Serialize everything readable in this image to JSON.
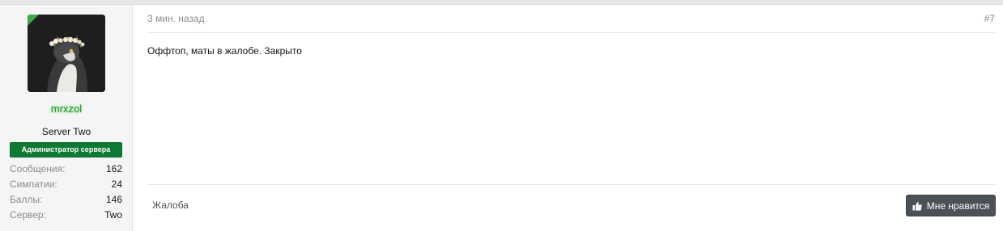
{
  "post": {
    "user": {
      "username": "mrxzol",
      "user_title": "Server Two",
      "role_banner": "Администратор сервера",
      "stats": [
        {
          "label": "Сообщения:",
          "value": "162"
        },
        {
          "label": "Симпатии:",
          "value": "24"
        },
        {
          "label": "Баллы:",
          "value": "146"
        },
        {
          "label": "Сервер:",
          "value": "Two"
        }
      ]
    },
    "timestamp": "3 мин. назад",
    "post_number": "#7",
    "message": "Оффтоп, маты в жалобе. Закрыто",
    "footer": {
      "report_label": "Жалоба",
      "like_label": "Мне нравится",
      "like_icon": "thumbs-up-icon"
    }
  },
  "colors": {
    "username": "#2c8a36",
    "role_banner": "#0f7a33",
    "online_badge": "#3ea845",
    "like_button": "#4c5157"
  }
}
